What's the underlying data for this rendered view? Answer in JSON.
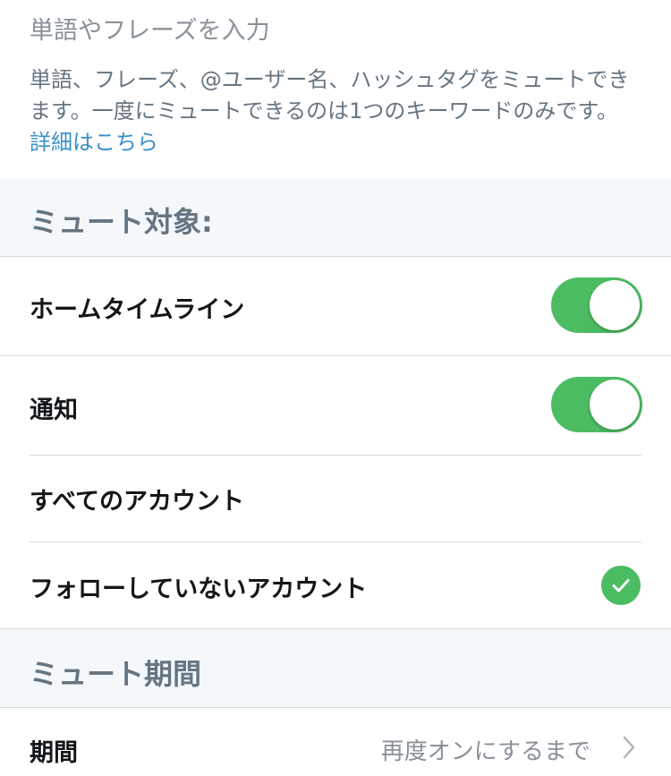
{
  "mute_input": {
    "placeholder": "単語やフレーズを入力",
    "description": "単語、フレーズ、@ユーザー名、ハッシュタグをミュートできます。一度にミュートできるのは1つのキーワードのみです。",
    "link_label": "詳細はこちら"
  },
  "mute_from": {
    "header": "ミュート対象:",
    "home_timeline": {
      "label": "ホームタイムライン",
      "enabled": true
    },
    "notifications": {
      "label": "通知",
      "enabled": true
    },
    "all_accounts": {
      "label": "すべてのアカウント",
      "selected": false
    },
    "not_following": {
      "label": "フォローしていないアカウント",
      "selected": true
    }
  },
  "mute_duration": {
    "header": "ミュート期間",
    "label": "期間",
    "value": "再度オンにするまで"
  },
  "colors": {
    "toggle_on": "#4cbc62",
    "link": "#3a90c8",
    "section_bg": "#f5f8fa"
  },
  "icons": {
    "check": "checkmark-icon",
    "chevron": "chevron-right-icon"
  }
}
